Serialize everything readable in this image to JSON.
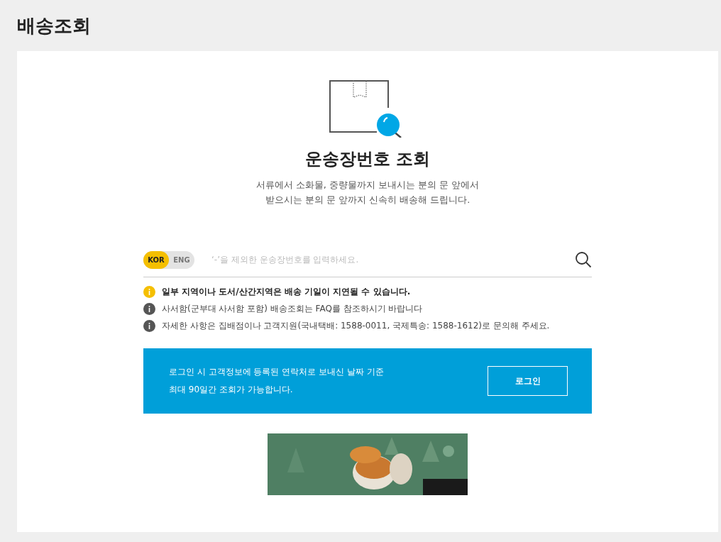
{
  "page_title": "배송조회",
  "heading": "운송장번호 조회",
  "description": [
    "서류에서 소화물, 중량물까지 보내시는 분의 문 앞에서",
    "받으시는 분의 문 앞까지 신속히 배송해 드립니다."
  ],
  "languages": [
    {
      "label": "KOR",
      "selected": true
    },
    {
      "label": "ENG",
      "selected": false
    }
  ],
  "search": {
    "placeholder": "‘-’을 제외한 운송장번호를 입력하세요."
  },
  "notices": [
    {
      "kind": "warning",
      "text": "일부 지역이나 도서/산간지역은 배송 기일이 지연될 수 있습니다."
    },
    {
      "kind": "info",
      "text": "사서함(군부대 사서함 포함) 배송조회는 FAQ를 참조하시기 바랍니다"
    },
    {
      "kind": "info",
      "text": "자세한 사항은 집배점이나 고객지원(국내택배: 1588-0011, 국제특송: 1588-1612)로 문의해 주세요."
    }
  ],
  "login_banner": {
    "lines": [
      "로그인 시 고객정보에 등록된 연락처로 보내신 날짜 기준",
      "최대 90일간 조회가 가능합니다."
    ],
    "button": "로그인"
  },
  "ad": {
    "kind": "picture"
  }
}
